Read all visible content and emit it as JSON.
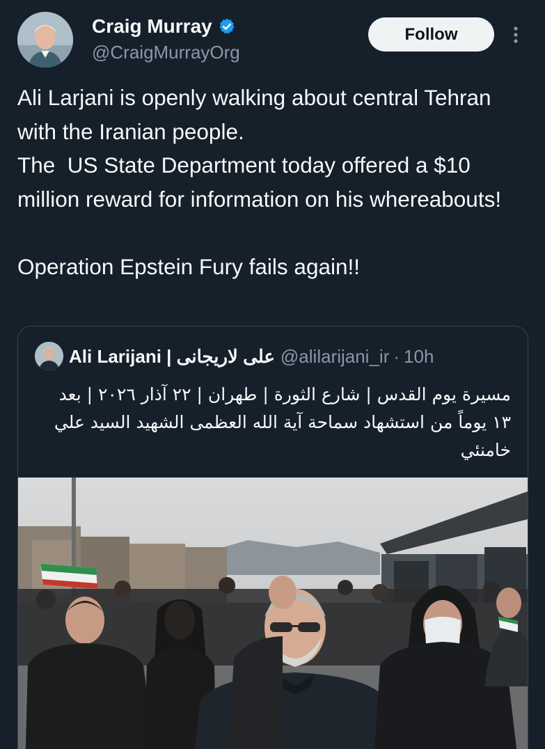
{
  "author": {
    "name": "Craig Murray",
    "handle": "@CraigMurrayOrg",
    "verified": true
  },
  "follow_label": "Follow",
  "more_icon": "more-vertical-icon",
  "tweet": {
    "text": "Ali Larjani is openly walking about central Tehran with the Iranian people.\nThe  US State Department today offered a $10 million reward for information on his whereabouts!\n\nOperation Epstein Fury fails again!!"
  },
  "quoted": {
    "name": "Ali Larijani | علی لاریجانی",
    "handle": "@alilarijani_ir",
    "separator": "·",
    "time": "10h",
    "text": "مسيرة يوم القدس | شارع الثورة | طهران | ٢٢ آذار ٢٠٢٦ | بعد ١٣ يوماً من استشهاد سماحة آية الله العظمى الشهيد السيد علي خامنئي",
    "photo": "street-march-photo"
  },
  "colors": {
    "background": "#15202b",
    "text": "#f7f9f9",
    "secondary": "#8b98a5",
    "verified": "#1d9bf0",
    "border": "#38444d",
    "button_bg": "#eff3f4"
  }
}
